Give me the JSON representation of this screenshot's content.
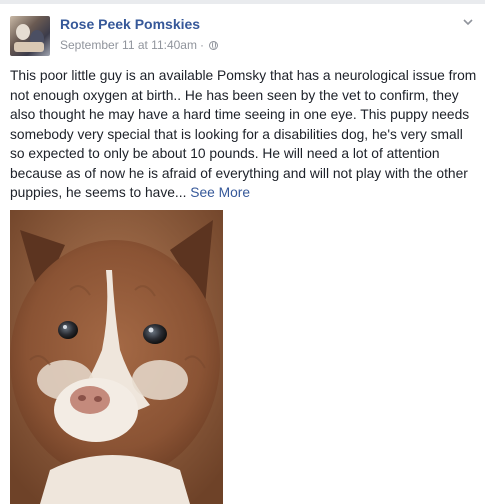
{
  "post": {
    "author": "Rose Peek Pomskies",
    "timestamp": "September 11 at 11:40am",
    "separator": "·",
    "privacy_icon": "globe-icon",
    "options_icon": "chevron-down-icon",
    "text": "This poor little guy is an available Pomsky that has a neurological issue from not enough oxygen at birth.. He has been seen by the vet to confirm, they also thought he may have a hard time seeing in one eye. This puppy needs somebody very special that is looking for a disabilities dog, he's very small so expected to only be about 10 pounds. He will need a lot of attention because as of now he is afraid of everything and will not play with the other puppies, he seems to have...",
    "see_more": "See More",
    "photo_subject": "brown-and-white-pomsky-puppy-photo"
  },
  "colors": {
    "link": "#365899",
    "meta": "#90949c",
    "text": "#1d2129"
  }
}
